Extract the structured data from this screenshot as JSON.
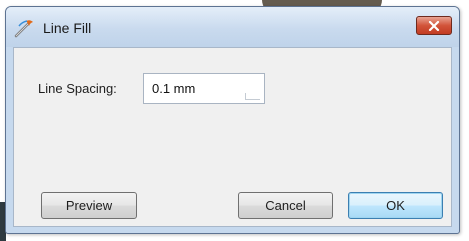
{
  "window": {
    "title": "Line Fill",
    "icon": "wand-icon",
    "close_icon": "close-icon"
  },
  "form": {
    "line_spacing_label": "Line Spacing:",
    "line_spacing_value": "0.1 mm"
  },
  "buttons": {
    "preview": "Preview",
    "cancel": "Cancel",
    "ok": "OK"
  },
  "colors": {
    "close_button": "#c23b22",
    "default_button_border": "#3c7fb1",
    "titlebar": "#c9daee"
  }
}
